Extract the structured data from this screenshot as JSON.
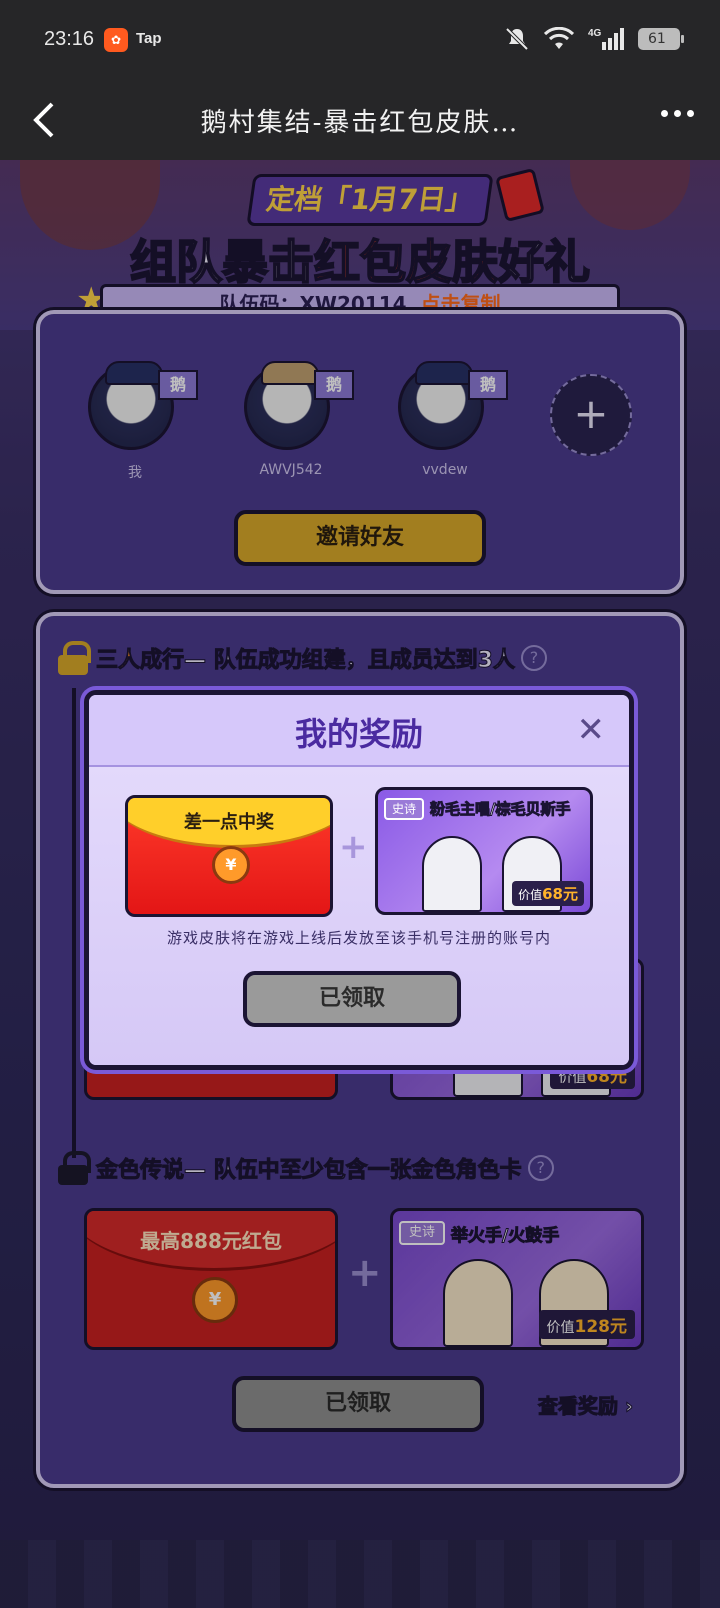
{
  "status_bar": {
    "time": "23:16",
    "app_badge": "Tap",
    "battery": "61"
  },
  "title_bar": {
    "title": "鹅村集结-暴击红包皮肤…"
  },
  "banner": {
    "date_tag": "定档「1月7日」",
    "heading_part1": "组队暴击",
    "heading_part2": "红包皮肤",
    "heading_part3": "好礼",
    "team_code_label": "队伍码：XW20114",
    "copy_label": "点击复制"
  },
  "team": {
    "members": [
      {
        "name": "我",
        "tag": "鹅"
      },
      {
        "name": "AWVJ542",
        "tag": "鹅"
      },
      {
        "name": "vvdew",
        "tag": "鹅"
      }
    ],
    "add_label": "+",
    "invite_button": "邀请好友"
  },
  "tiers": [
    {
      "title": "三人成行",
      "desc": "— 队伍成功组建，且成员达到3人"
    },
    {
      "title": "金色传说",
      "desc": "— 队伍中至少包含一张金色角色卡"
    }
  ],
  "tier3_reward": {
    "redpacket_label": "最高888元红包",
    "coin": "¥",
    "skin_tag": "史诗",
    "skin_name": "举火手/火鼓手",
    "price_prefix": "价值",
    "price": "128元"
  },
  "tier2_partial": {
    "price_prefix": "价值",
    "price": "68元"
  },
  "bottom": {
    "claimed_button": "已领取",
    "view_rewards": "查看奖励 ›"
  },
  "modal": {
    "title": "我的奖励",
    "close": "✕",
    "redpacket_label": "差一点中奖",
    "coin": "¥",
    "plus": "+",
    "skin_tag": "史诗",
    "skin_name": "粉毛主唱/棕毛贝斯手",
    "price_prefix": "价值",
    "price": "68元",
    "note": "游戏皮肤将在游戏上线后发放至该手机号注册的账号内",
    "claimed_button": "已领取"
  }
}
